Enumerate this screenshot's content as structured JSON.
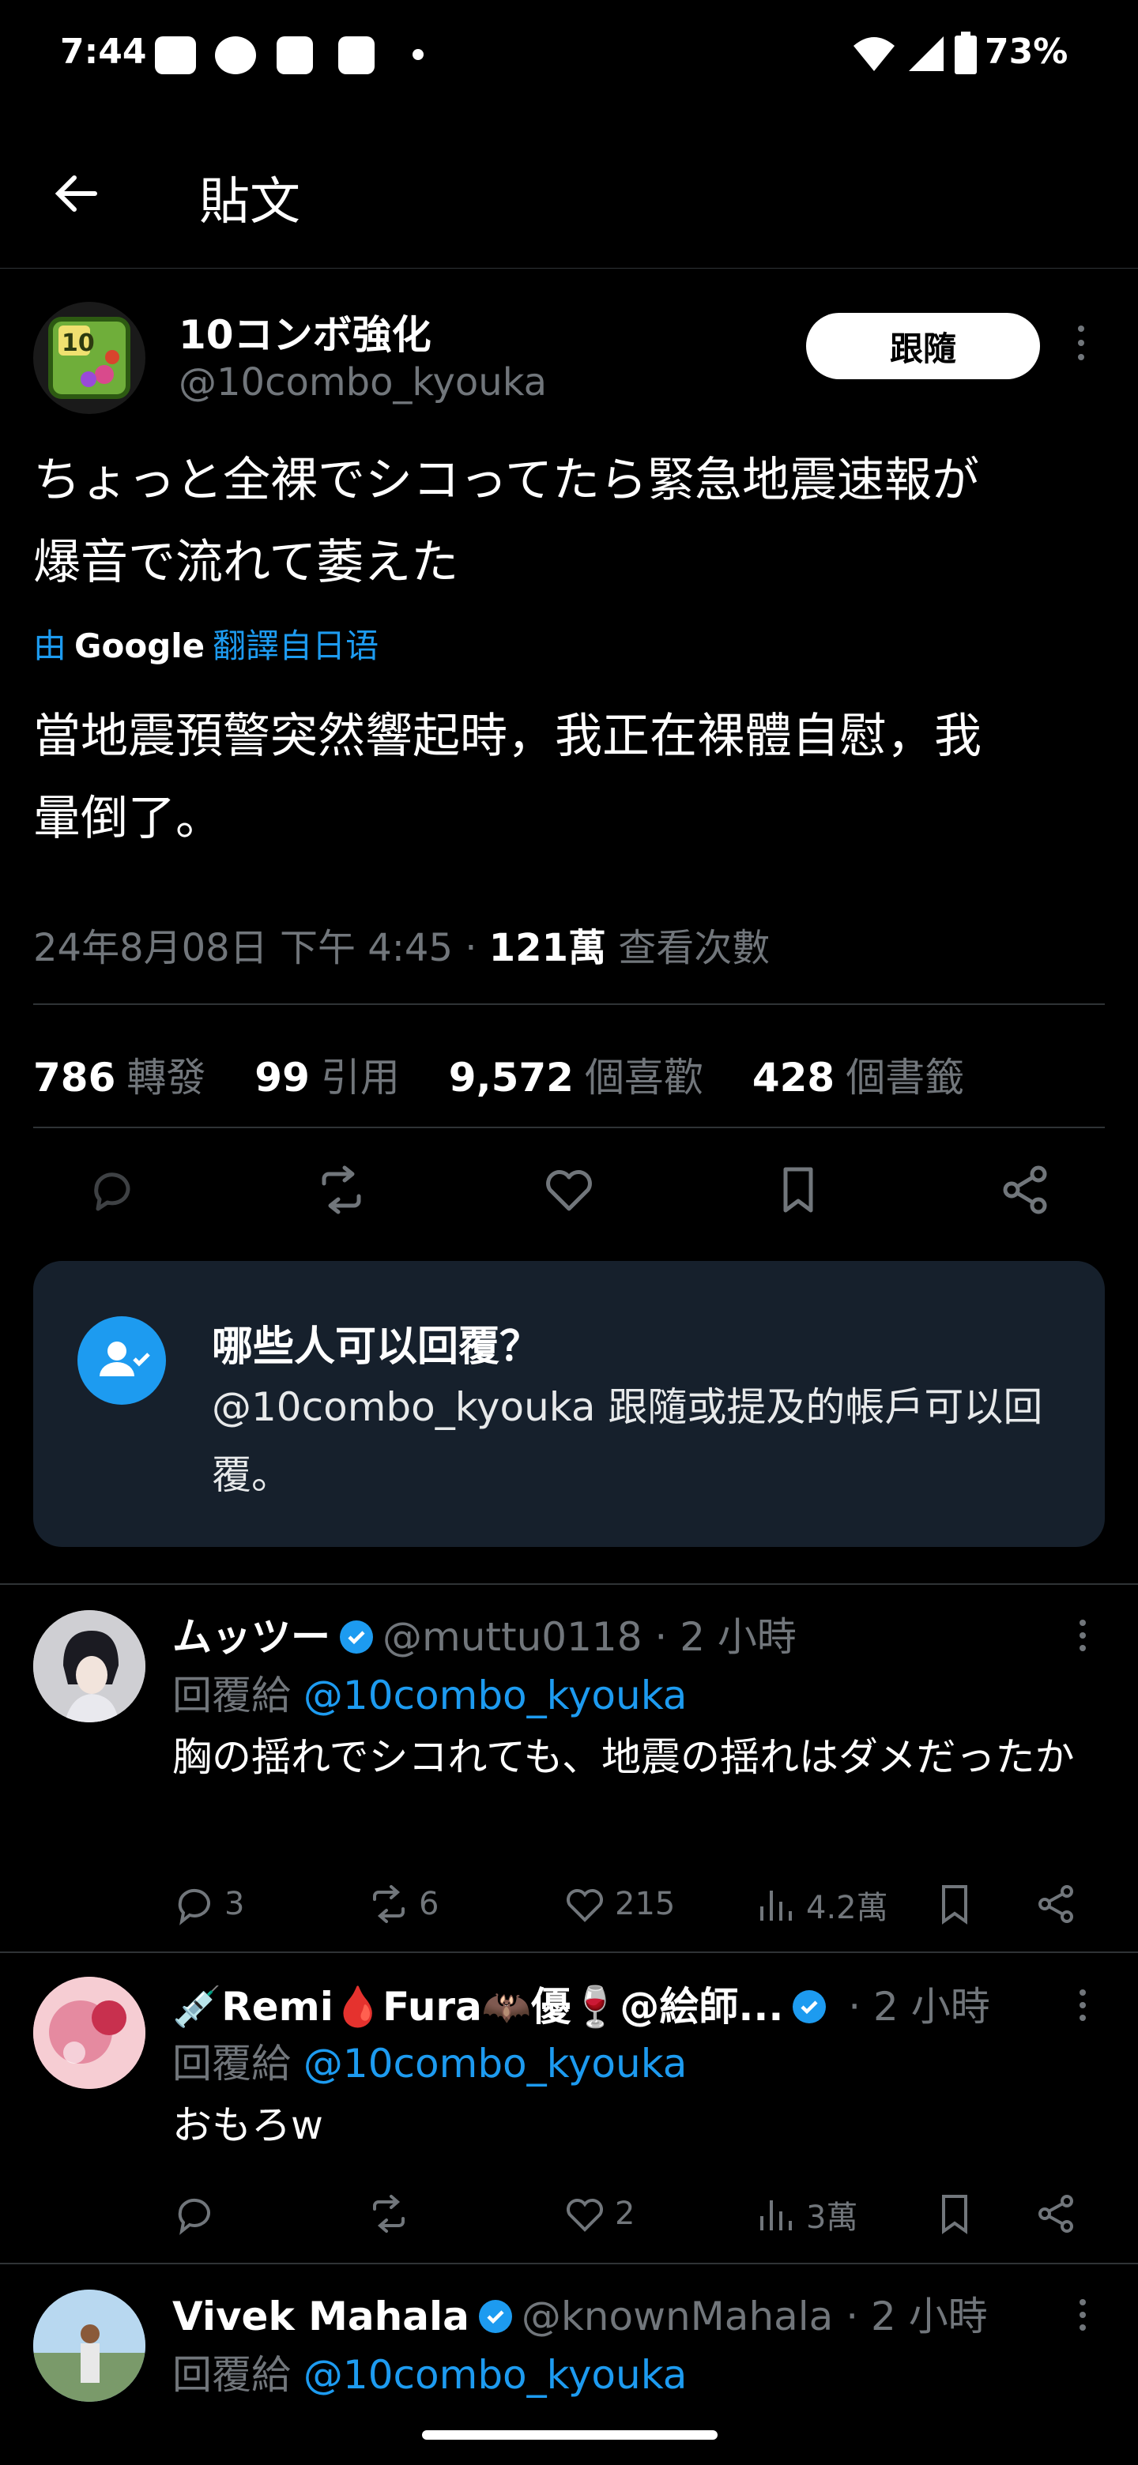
{
  "status_bar": {
    "time": "7:44",
    "battery": "73%"
  },
  "header": {
    "title": "貼文"
  },
  "post": {
    "display_name": "10コンボ強化",
    "handle": "@10combo_kyouka",
    "follow_label": "跟隨",
    "text_line1": "ちょっと全裸でシコってたら緊急地震速報が",
    "text_line2": "爆音で流れて萎えた",
    "translate_prefix": "由",
    "translate_brand": "Google",
    "translate_suffix": "翻譯自日语",
    "translated_line1": "當地震預警突然響起時，我正在裸體自慰，我",
    "translated_line2": "暈倒了。",
    "date": "24年8月08日 下午 4:45 · ",
    "views_count": "121萬",
    "views_label": " 查看次數",
    "stats": {
      "reposts_n": "786",
      "reposts_l": "轉發",
      "quotes_n": "99",
      "quotes_l": "引用",
      "likes_n": "9,572",
      "likes_l": "個喜歡",
      "bookmarks_n": "428",
      "bookmarks_l": "個書籤"
    },
    "who_can_reply_title": "哪些人可以回覆？",
    "who_can_reply_body": "@10combo_kyouka 跟隨或提及的帳戶可以回覆。"
  },
  "replies": [
    {
      "name": "ムッツー",
      "handle": "@muttu0118 · 2 小時",
      "reply_to_label": "回覆給 ",
      "reply_to": "@10combo_kyouka",
      "text": "胸の揺れでシコれても、地震の揺れはダメだったか",
      "comments": "3",
      "reposts": "6",
      "likes": "215",
      "views": "4.2萬"
    },
    {
      "name": "💉Remi🩸Fura🦇優🍷@絵師...",
      "handle": " · 2 小時",
      "reply_to_label": "回覆給 ",
      "reply_to": "@10combo_kyouka",
      "text": "おもろw",
      "comments": "",
      "reposts": "",
      "likes": "2",
      "views": "3萬"
    },
    {
      "name": "Vivek Mahala",
      "handle": "@knownMahala · 2 小時",
      "reply_to_label": "回覆給 ",
      "reply_to": "@10combo_kyouka"
    }
  ],
  "colors": {
    "accent": "#1d9bf0",
    "background": "#000000",
    "card": "#16202c"
  }
}
